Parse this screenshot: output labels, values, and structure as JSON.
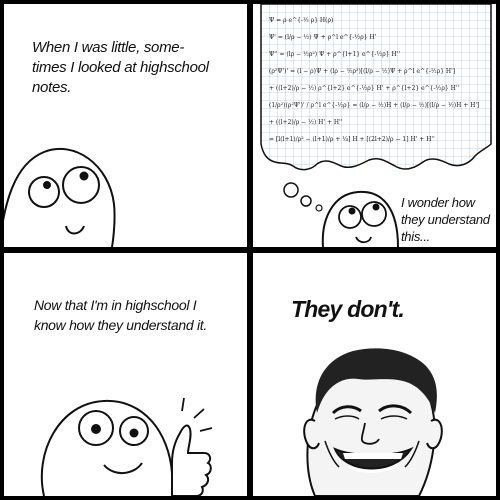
{
  "panels": [
    {
      "caption": "When I was little, some-\ntimes I looked at highschool\nnotes."
    },
    {
      "caption": "I wonder how\nthey understand\nthis...",
      "notes": [
        "Ψ = ρ e^{-½ ρ} H(ρ)",
        "Ψ' = (l/ρ − ½) Ψ + ρ^l e^{-½ρ} H'",
        "Ψ'' = (lρ − ½ρ²) Ψ + ρ^{l+1} e^{-½ρ} H''",
        "(ρ²Ψ')' = (l − ρ)Ψ + (lρ − ½ρ²)[(l/ρ − ½)Ψ + ρ^l e^{-½ρ} H']",
        "+ ((l+2)/ρ − ½) ρ^{l+2} e^{-½ρ} H' + ρ^{l+2} e^{-½ρ} H''",
        "(1/ρ²)(ρ²Ψ')' / ρ^l e^{-½ρ} = (l/ρ − ½)H + (l/ρ − ½)[(l/ρ − ½)H + H']",
        "+ ((l+2)/ρ − ½) H' + H''",
        "= [l(l+1)/ρ² − (l+1)/ρ + ¼] H + [(2l+2)/ρ − 1] H' + H''"
      ]
    },
    {
      "caption": "Now that I'm in highschool I\nknow how they understand it."
    },
    {
      "caption": "They don't."
    }
  ]
}
